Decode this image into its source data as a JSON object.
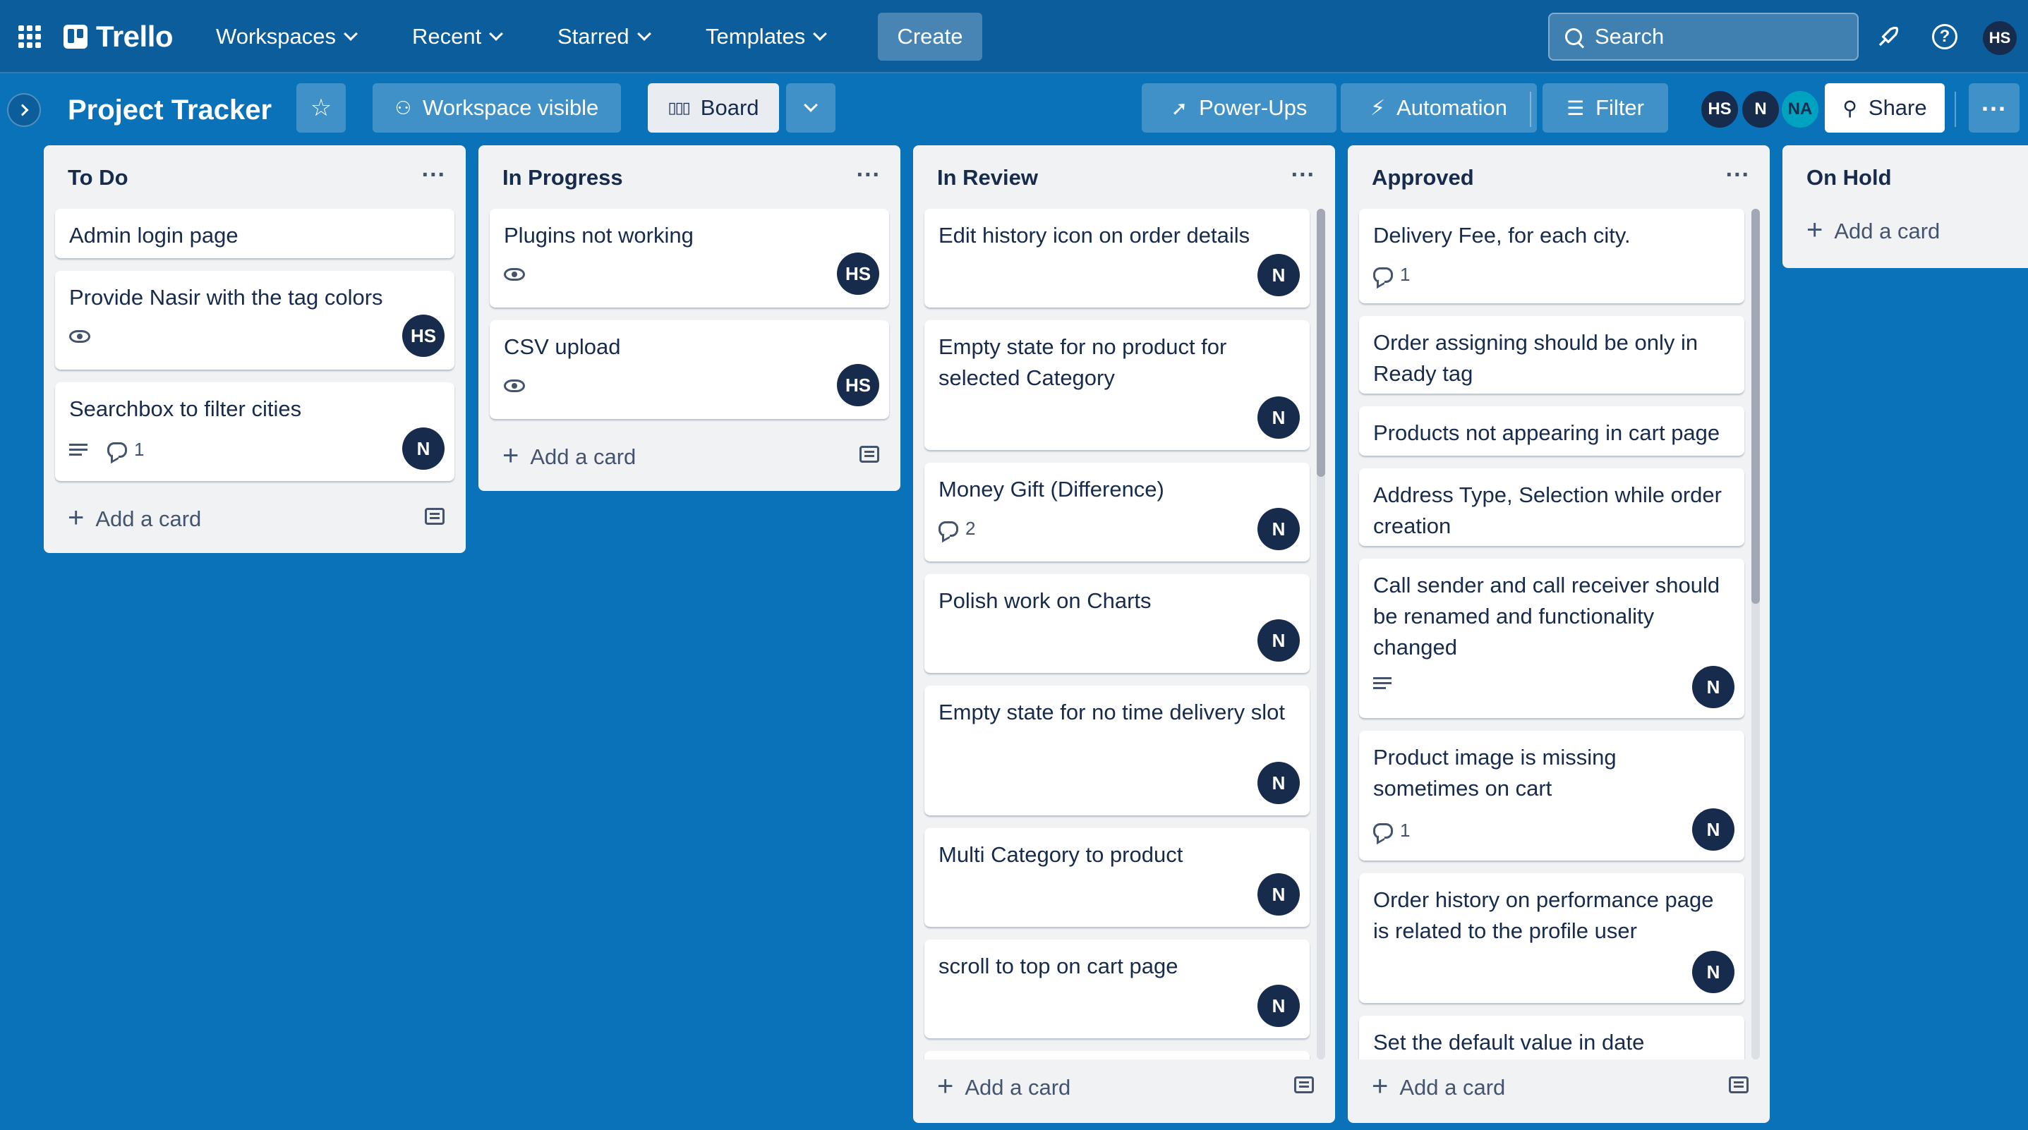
{
  "topbar": {
    "logo": "Trello",
    "nav": [
      "Workspaces",
      "Recent",
      "Starred",
      "Templates"
    ],
    "create": "Create",
    "search_placeholder": "Search",
    "user_initials": "HS"
  },
  "board": {
    "title": "Project Tracker",
    "visibility": "Workspace visible",
    "view": "Board",
    "power_ups": "Power-Ups",
    "automation": "Automation",
    "filter": "Filter",
    "members": [
      "HS",
      "N",
      "NA"
    ],
    "share": "Share"
  },
  "colors": {
    "background": "#0a72b8",
    "topbar": "#0b5d9c",
    "list_bg": "#f1f2f4",
    "avatar": "#172b4d",
    "avatar_na": "#00a3bf"
  },
  "lists": [
    {
      "title": "To Do",
      "add_card": "Add a card",
      "cards": [
        {
          "title": "Admin login page"
        },
        {
          "title": "Provide Nasir with the tag colors",
          "watch": true,
          "member": "HS"
        },
        {
          "title": "Searchbox to filter cities",
          "description": true,
          "comments": "1",
          "member": "N"
        }
      ]
    },
    {
      "title": "In Progress",
      "add_card": "Add a card",
      "cards": [
        {
          "title": "Plugins not working",
          "watch": true,
          "member": "HS"
        },
        {
          "title": "CSV upload",
          "watch": true,
          "member": "HS"
        }
      ]
    },
    {
      "title": "In Review",
      "add_card": "Add a card",
      "cards": [
        {
          "title": "Edit history icon on order details",
          "member": "N"
        },
        {
          "title": "Empty state for no product for selected Category",
          "member": "N"
        },
        {
          "title": "Money Gift (Difference)",
          "comments": "2",
          "member": "N"
        },
        {
          "title": "Polish work on Charts",
          "member": "N"
        },
        {
          "title": "Empty state for no time delivery slot",
          "member": "N"
        },
        {
          "title": "Multi Category to product",
          "member": "N"
        },
        {
          "title": "scroll to top on cart page",
          "member": "N"
        }
      ]
    },
    {
      "title": "Approved",
      "add_card": "Add a card",
      "cards": [
        {
          "title": "Delivery Fee, for each city.",
          "comments": "1"
        },
        {
          "title": "Order assigning should be only in Ready tag"
        },
        {
          "title": "Products not appearing in cart page"
        },
        {
          "title": "Address Type, Selection while order creation"
        },
        {
          "title": "Call sender and call receiver should be renamed and functionality changed",
          "description": true,
          "member": "N"
        },
        {
          "title": "Product image is missing sometimes on cart",
          "comments": "1",
          "member": "N"
        },
        {
          "title": "Order history on performance page is related to the profile user",
          "member": "N"
        },
        {
          "title": "Set the default value in date"
        }
      ]
    },
    {
      "title": "On Hold",
      "add_card": "Add a card",
      "cards": []
    }
  ]
}
